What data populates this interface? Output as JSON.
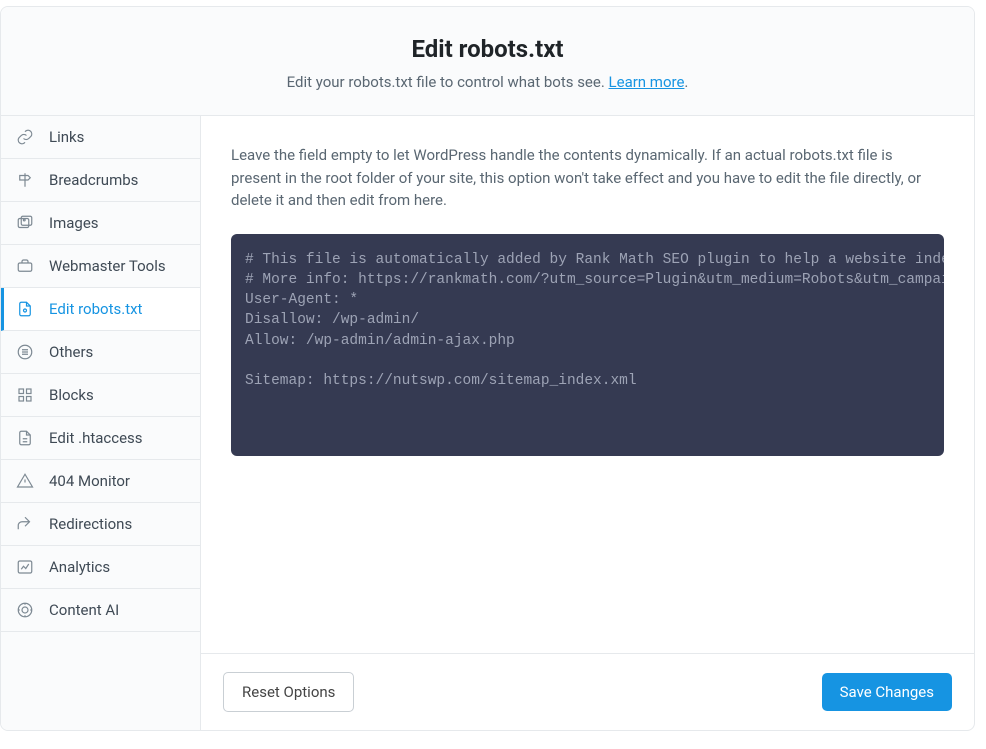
{
  "header": {
    "title": "Edit robots.txt",
    "subtitle_pre": "Edit your robots.txt file to control what bots see. ",
    "learn_more": "Learn more",
    "subtitle_post": "."
  },
  "sidebar": {
    "items": [
      {
        "id": "links",
        "label": "Links"
      },
      {
        "id": "breadcrumbs",
        "label": "Breadcrumbs"
      },
      {
        "id": "images",
        "label": "Images"
      },
      {
        "id": "webmaster-tools",
        "label": "Webmaster Tools"
      },
      {
        "id": "edit-robots",
        "label": "Edit robots.txt"
      },
      {
        "id": "others",
        "label": "Others"
      },
      {
        "id": "blocks",
        "label": "Blocks"
      },
      {
        "id": "edit-htaccess",
        "label": "Edit .htaccess"
      },
      {
        "id": "404-monitor",
        "label": "404 Monitor"
      },
      {
        "id": "redirections",
        "label": "Redirections"
      },
      {
        "id": "analytics",
        "label": "Analytics"
      },
      {
        "id": "content-ai",
        "label": "Content AI"
      }
    ]
  },
  "content": {
    "description": "Leave the field empty to let WordPress handle the contents dynamically. If an actual robots.txt file is present in the root folder of your site, this option won't take effect and you have to edit the file directly, or delete it and then edit from here.",
    "robots_txt": "# This file is automatically added by Rank Math SEO plugin to help a website index better\n# More info: https://rankmath.com/?utm_source=Plugin&utm_medium=Robots&utm_campaign=WP\nUser-Agent: *\nDisallow: /wp-admin/\nAllow: /wp-admin/admin-ajax.php\n\nSitemap: https://nutswp.com/sitemap_index.xml"
  },
  "footer": {
    "reset_label": "Reset Options",
    "save_label": "Save Changes"
  }
}
